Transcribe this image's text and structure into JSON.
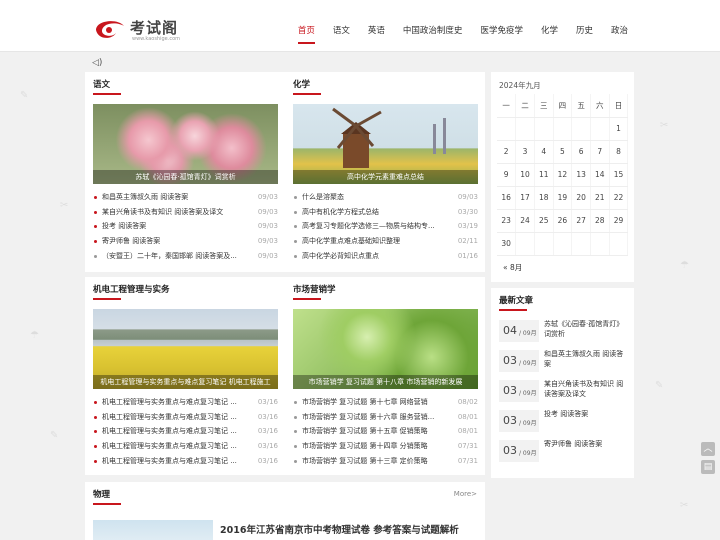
{
  "header": {
    "logo_text": "考试阁",
    "logo_sub": "www.kaoshige.com",
    "nav": [
      {
        "label": "首页",
        "active": true
      },
      {
        "label": "语文",
        "active": false
      },
      {
        "label": "英语",
        "active": false
      },
      {
        "label": "中国政治制度史",
        "active": false
      },
      {
        "label": "医学免疫学",
        "active": false
      },
      {
        "label": "化学",
        "active": false
      },
      {
        "label": "历史",
        "active": false
      },
      {
        "label": "政治",
        "active": false
      }
    ]
  },
  "yuwen": {
    "title": "语文",
    "caption": "苏轼《沁园春·孤馆青灯》词赏析",
    "items": [
      {
        "title": "和昌英主簿叔久雨 阅读答案",
        "date": "09/03"
      },
      {
        "title": "某自兴角读书及有知识 阅读答案及译文",
        "date": "09/03"
      },
      {
        "title": "投考 阅读答案",
        "date": "09/03"
      },
      {
        "title": "寄尹师鲁 阅读答案",
        "date": "09/03"
      },
      {
        "title": "（安暨王）二十年，秦国邯郸 阅读答案及...",
        "date": "09/03"
      }
    ]
  },
  "huaxue": {
    "title": "化学",
    "caption": "高中化学元素重难点总结",
    "items": [
      {
        "title": "什么是溶聚态",
        "date": "09/03"
      },
      {
        "title": "高中有机化学方程式总结",
        "date": "03/30"
      },
      {
        "title": "高考复习专题化学选修三—物质与结构专...",
        "date": "03/19"
      },
      {
        "title": "高中化学重点难点基础知识整理",
        "date": "02/11"
      },
      {
        "title": "高中化学必背知识点重点",
        "date": "01/16"
      }
    ]
  },
  "jidian": {
    "title": "机电工程管理与实务",
    "caption": "机电工程管理与实务重点与难点复习笔记 机电工程施工",
    "items": [
      {
        "title": "机电工程管理与实务重点与难点复习笔记 ...",
        "date": "03/16"
      },
      {
        "title": "机电工程管理与实务重点与难点复习笔记 ...",
        "date": "03/16"
      },
      {
        "title": "机电工程管理与实务重点与难点复习笔记 ...",
        "date": "03/16"
      },
      {
        "title": "机电工程管理与实务重点与难点复习笔记 ...",
        "date": "03/16"
      },
      {
        "title": "机电工程管理与实务重点与难点复习笔记 ...",
        "date": "03/16"
      }
    ]
  },
  "shichang": {
    "title": "市场营销学",
    "caption": "市场营销学 复习试题 第十八章 市场营销的新发展",
    "items": [
      {
        "title": "市场营销学 复习试题 第十七章 网络营销",
        "date": "08/02"
      },
      {
        "title": "市场营销学 复习试题 第十六章 服务营销...",
        "date": "08/01"
      },
      {
        "title": "市场营销学 复习试题 第十五章 促销策略",
        "date": "08/01"
      },
      {
        "title": "市场营销学 复习试题 第十四章 分销策略",
        "date": "07/31"
      },
      {
        "title": "市场营销学 复习试题 第十三章 定价策略",
        "date": "07/31"
      }
    ]
  },
  "calendar": {
    "caption": "2024年九月",
    "weekdays": [
      "一",
      "二",
      "三",
      "四",
      "五",
      "六",
      "日"
    ],
    "rows": [
      [
        "",
        "",
        "",
        "",
        "",
        "",
        "1"
      ],
      [
        "2",
        "3",
        "4",
        "5",
        "6",
        "7",
        "8"
      ],
      [
        "9",
        "10",
        "11",
        "12",
        "13",
        "14",
        "15"
      ],
      [
        "16",
        "17",
        "18",
        "19",
        "20",
        "21",
        "22"
      ],
      [
        "23",
        "24",
        "25",
        "26",
        "27",
        "28",
        "29"
      ],
      [
        "30",
        "",
        "",
        "",
        "",
        "",
        ""
      ]
    ],
    "prev": "« 8月"
  },
  "latest": {
    "title": "最新文章",
    "items": [
      {
        "day": "04",
        "month": "/ 09月",
        "title": "苏轼《沁园春·孤馆青灯》词赏析"
      },
      {
        "day": "03",
        "month": "/ 09月",
        "title": "和昌英主簿叔久雨 阅读答案"
      },
      {
        "day": "03",
        "month": "/ 09月",
        "title": "某自兴角读书及有知识 阅读答案及译文"
      },
      {
        "day": "03",
        "month": "/ 09月",
        "title": "投考 阅读答案"
      },
      {
        "day": "03",
        "month": "/ 09月",
        "title": "寄尹师鲁 阅读答案"
      }
    ]
  },
  "physics": {
    "title": "物理",
    "more": "More>",
    "headline": "2016年江苏省南京市中考物理试卷 参考答案与试题解析"
  },
  "icons": {
    "speaker": "speaker-icon",
    "top": "back-to-top-icon",
    "feedback": "feedback-icon"
  },
  "colors": {
    "accent": "#c8161d",
    "background": "#f1f1f1"
  }
}
